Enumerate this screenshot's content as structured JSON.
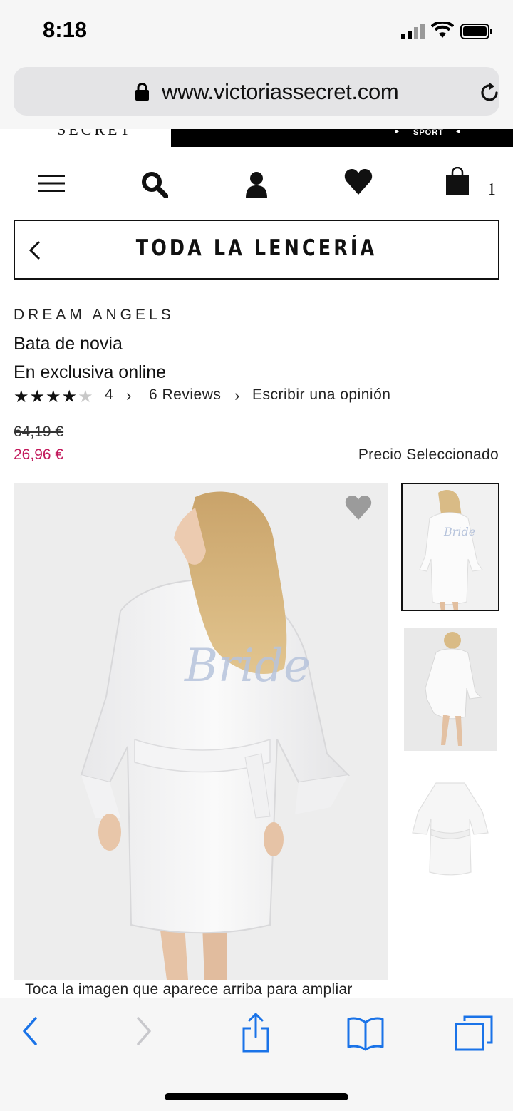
{
  "status_bar": {
    "time": "8:18"
  },
  "browser": {
    "url": "www.victoriassecret.com"
  },
  "site_banner": {
    "brand_fragment": "SECRET",
    "sport_fragment": "SPORT"
  },
  "nav": {
    "bag_count": "1"
  },
  "category": {
    "title": "TODA LA LENCERÍA"
  },
  "product": {
    "brand": "DREAM ANGELS",
    "name": "Bata de novia",
    "exclusive": "En exclusiva online",
    "rating": {
      "stars_filled": 4,
      "stars_total": 5,
      "value": "4"
    },
    "reviews_link": "6 Reviews",
    "write_review_link": "Escribir una opinión",
    "old_price": "64,19 €",
    "sale_price": "26,96 €",
    "price_label": "Precio Seleccionado",
    "zoom_hint": "Toca la imagen que aparece arriba para ampliar"
  },
  "colors": {
    "sale": "#c2185b",
    "safari_blue": "#1a73e8"
  }
}
